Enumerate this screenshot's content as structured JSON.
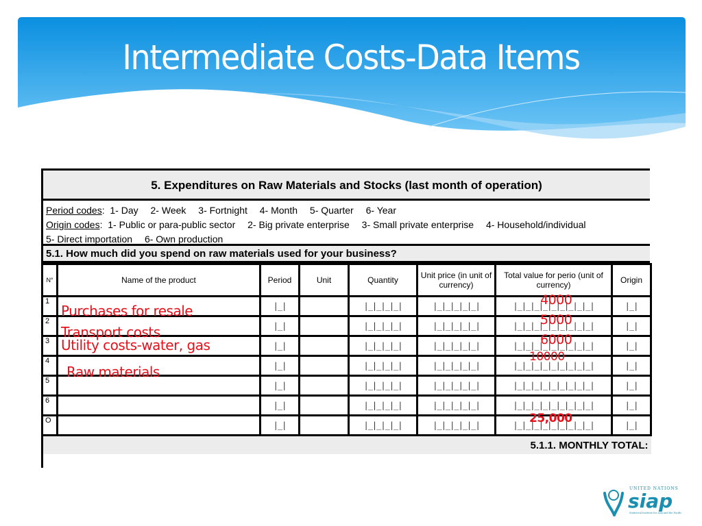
{
  "slide": {
    "title": "Intermediate Costs-Data Items",
    "accent_color": "#1293e0"
  },
  "form": {
    "section_title": "5.  Expenditures on Raw Materials and Stocks (last month of operation)",
    "period_codes": {
      "label": "Period codes",
      "items": [
        "1- Day",
        "2- Week",
        "3- Fortnight",
        "4- Month",
        "5- Quarter",
        "6- Year"
      ]
    },
    "origin_codes": {
      "label": "Origin codes",
      "items": [
        "1- Public or para-public sector",
        "2- Big private enterprise",
        "3- Small private enterprise",
        "4- Household/individual",
        "5- Direct importation",
        "6- Own production"
      ]
    },
    "question": "5.1.   How much did you spend on raw materials used for your business?",
    "columns": {
      "no": "N°",
      "name": "Name of the product",
      "period": "Period",
      "unit": "Unit",
      "quantity": "Quantity",
      "unit_price": "Unit price (in unit of currency)",
      "total_value": "Total value for perio (unit of currency)",
      "origin": "Origin"
    },
    "rows": [
      {
        "no": "1",
        "name": "Purchases for resale",
        "total": "4000"
      },
      {
        "no": "2",
        "name": "Transport costs",
        "total": "5000"
      },
      {
        "no": "3",
        "name": "Utility costs-water, gas",
        "total": "6000"
      },
      {
        "no": "4",
        "name": "Raw materials",
        "total": "10000"
      },
      {
        "no": "5",
        "name": "",
        "total": ""
      },
      {
        "no": "6",
        "name": "",
        "total": ""
      },
      {
        "no": "O",
        "name": "",
        "total": "25,000"
      }
    ],
    "box_glyphs": {
      "period": "|_|",
      "quantity": "|_|_|_|_|",
      "unit_price": "|_|_|_|_|_|",
      "total_value": "|_|_|_|_|_|_|_|_|_|",
      "origin": "|_|"
    },
    "monthly_total_label": "5.1.1.  MONTHLY TOTAL:"
  },
  "logo": {
    "top_text": "UNITED NATIONS",
    "name": "siap",
    "subtitle": "Statistical Institute for Asia and the Pacific"
  }
}
